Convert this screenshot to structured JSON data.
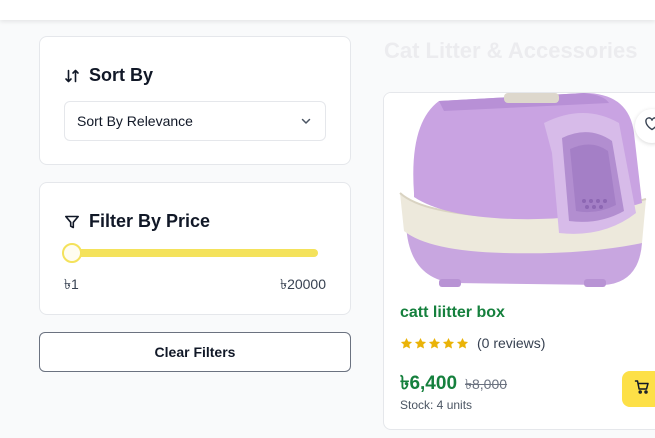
{
  "sidebar": {
    "sort": {
      "title": "Sort By",
      "icon": "sort-arrows-icon",
      "selected_option": "Sort By Relevance"
    },
    "price_filter": {
      "title": "Filter By Price",
      "icon": "filter-funnel-icon",
      "range_min_label": "৳1",
      "range_max_label": "৳20000",
      "selected_min_fraction": 0,
      "selected_max_fraction": 1
    },
    "clear_label": "Clear Filters"
  },
  "main": {
    "heading": "Cat Litter & Accessories",
    "products": [
      {
        "name": "catt liitter box",
        "rating": 5,
        "reviews": "(0 reviews)",
        "price": "৳6,400",
        "old_price": "৳8,000",
        "stock": "Stock: 4 units",
        "image_icon": "lilac-covered-litter-box"
      }
    ]
  },
  "colors": {
    "accent_green": "#15803d",
    "accent_yellow": "#fde047",
    "slider_yellow": "#f4e25b",
    "star": "#eab308"
  }
}
